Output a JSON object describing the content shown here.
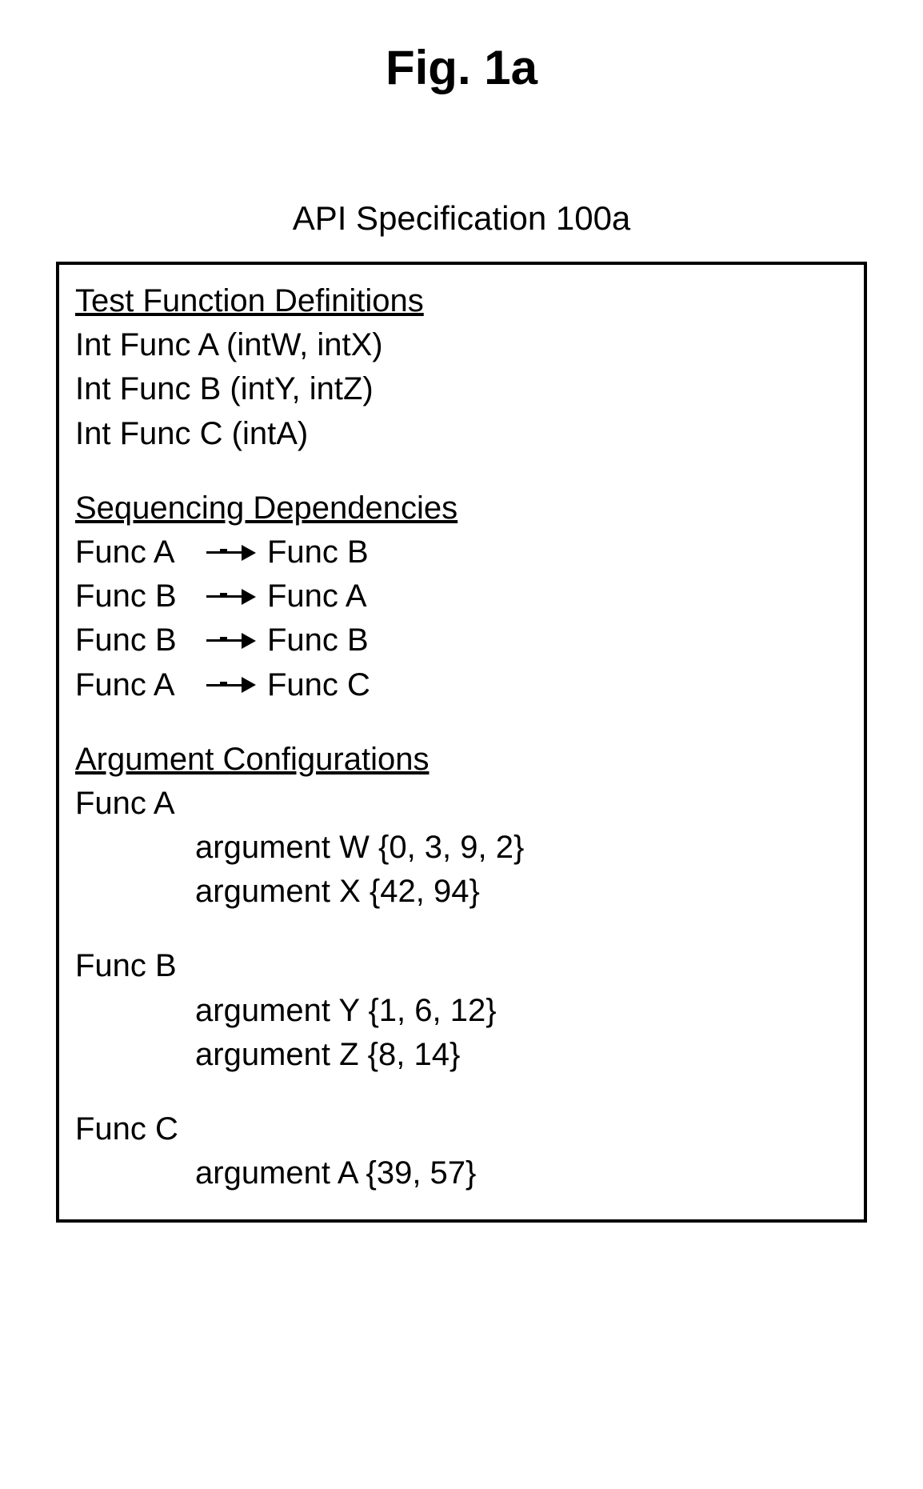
{
  "figure_title": "Fig. 1a",
  "api_title": "API Specification 100a",
  "sections": {
    "definitions": {
      "heading": "Test Function Definitions",
      "lines": [
        "Int Func A (intW, intX)",
        "Int Func B (intY, intZ)",
        "Int Func C (intA)"
      ]
    },
    "sequencing": {
      "heading": "Sequencing Dependencies",
      "deps": [
        {
          "from": "Func A",
          "to": "Func B"
        },
        {
          "from": "Func B",
          "to": "Func A"
        },
        {
          "from": "Func B",
          "to": "Func B"
        },
        {
          "from": "Func A",
          "to": "Func C"
        }
      ]
    },
    "arguments": {
      "heading": "Argument Configurations",
      "funcs": [
        {
          "name": "Func A",
          "args": [
            "argument W {0, 3, 9, 2}",
            "argument X {42, 94}"
          ]
        },
        {
          "name": "Func B",
          "args": [
            "argument Y {1, 6, 12}",
            "argument Z {8, 14}"
          ]
        },
        {
          "name": "Func C",
          "args": [
            "argument A {39, 57}"
          ]
        }
      ]
    }
  }
}
